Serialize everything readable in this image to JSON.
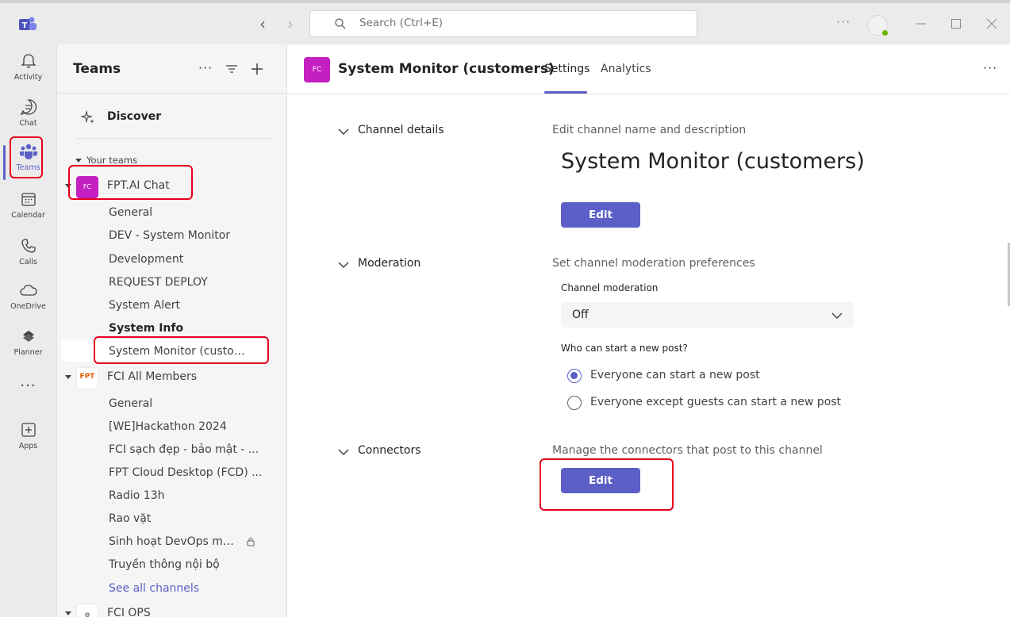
{
  "titlebar": {
    "search_placeholder": "Search (Ctrl+E)",
    "more": "···"
  },
  "rail": {
    "items": [
      {
        "label": "Activity",
        "icon": "bell-icon"
      },
      {
        "label": "Chat",
        "icon": "chat-icon"
      },
      {
        "label": "Teams",
        "icon": "teams-icon",
        "active": true
      },
      {
        "label": "Calendar",
        "icon": "calendar-icon"
      },
      {
        "label": "Calls",
        "icon": "phone-icon"
      },
      {
        "label": "OneDrive",
        "icon": "cloud-icon"
      },
      {
        "label": "Planner",
        "icon": "planner-icon"
      },
      {
        "label": "Apps",
        "icon": "plus-square-icon"
      }
    ],
    "more": "···"
  },
  "teams_panel": {
    "title": "Teams",
    "more": "···",
    "discover": "Discover",
    "section_label": "Your teams",
    "teams": [
      {
        "name": "FPT.AI Chat",
        "avatar_text": "FC",
        "avatar_color": "#c41fc1",
        "channels": [
          "General",
          "DEV - System Monitor",
          "Development",
          "REQUEST DEPLOY",
          "System Alert",
          "System Info",
          "System Monitor (customers)"
        ]
      },
      {
        "name": "FCI All Members",
        "avatar_text": "FPT",
        "channels": [
          "General",
          "[WE]Hackathon 2024",
          "FCI sạch đẹp - bảo mật - ...",
          "FPT Cloud Desktop (FCD) ...",
          "Radio 13h",
          "Rao vặt",
          "Sinh hoạt DevOps mon...",
          "Truyền thông nội bộ"
        ],
        "see_all": "See all channels"
      },
      {
        "name": "FCI OPS"
      }
    ]
  },
  "main": {
    "channel_avatar": "FC",
    "channel_title": "System Monitor (customers)",
    "tabs": [
      "Settings",
      "Analytics"
    ],
    "more": "···",
    "sections": {
      "channel_details": {
        "name": "Channel details",
        "description": "Edit channel name and description",
        "channel_name": "System Monitor (customers)",
        "button": "Edit"
      },
      "moderation": {
        "name": "Moderation",
        "description": "Set channel moderation preferences",
        "field_label": "Channel moderation",
        "selected": "Off",
        "question": "Who can start a new post?",
        "options": [
          "Everyone can start a new post",
          "Everyone except guests can start a new post"
        ],
        "selected_option": 0
      },
      "connectors": {
        "name": "Connectors",
        "description": "Manage the connectors that post to this channel",
        "button": "Edit"
      }
    }
  },
  "accent_color": "#5b5fc7",
  "highlight_color": "#e8001c"
}
